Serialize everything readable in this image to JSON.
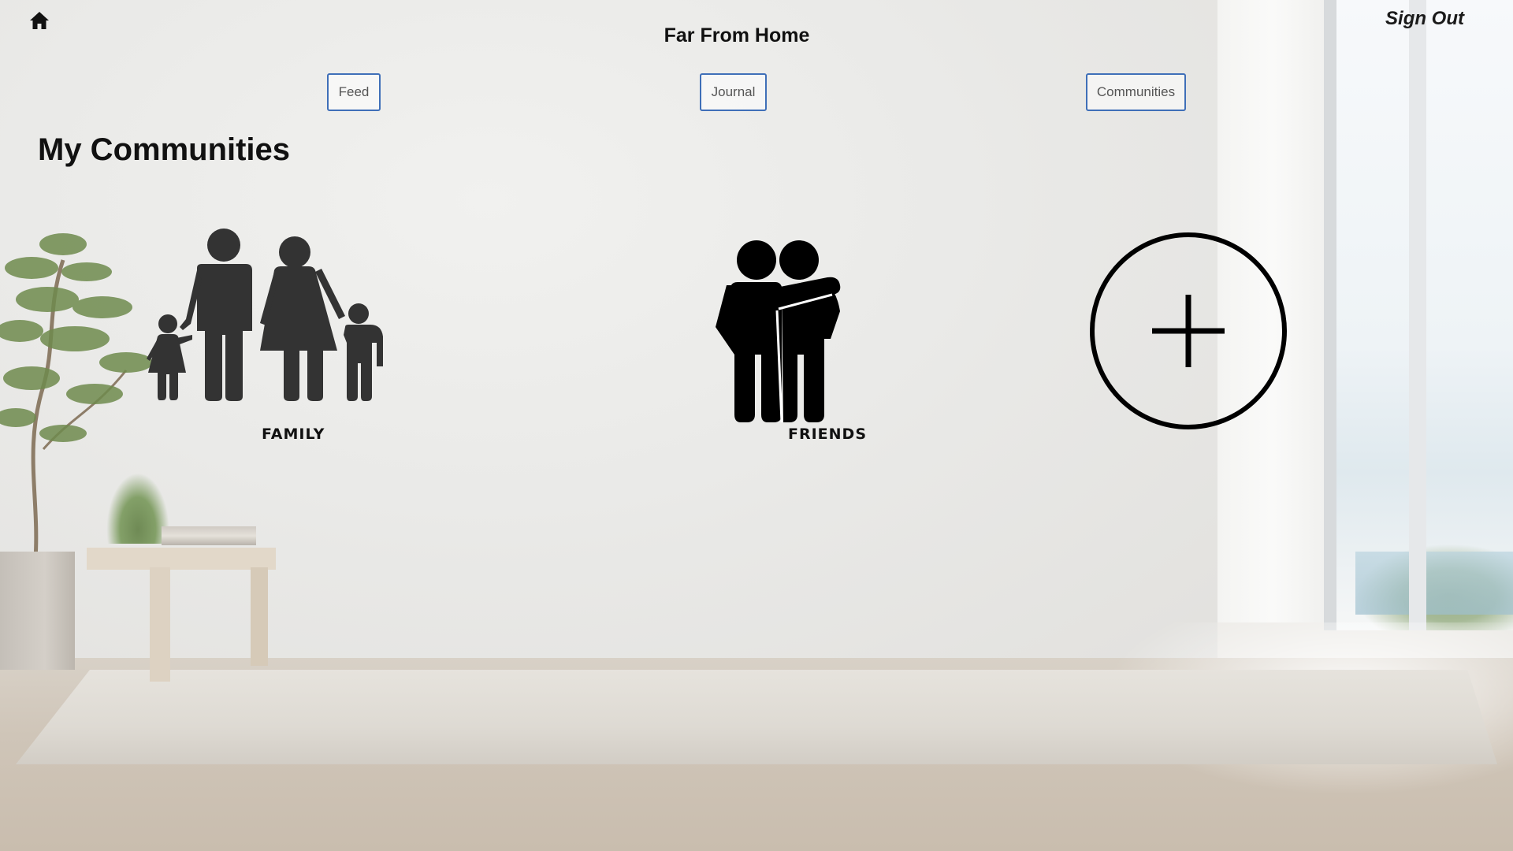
{
  "app": {
    "title": "Far From Home",
    "sign_out_label": "Sign Out"
  },
  "nav": {
    "feed": "Feed",
    "journal": "Journal",
    "communities": "Communities"
  },
  "page": {
    "section_title": "My Communities"
  },
  "communities": [
    {
      "label": "FAMILY",
      "icon": "family-icon"
    },
    {
      "label": "FRIENDS",
      "icon": "friends-icon"
    }
  ],
  "add_community": {
    "icon": "add-circle-icon"
  },
  "icons": {
    "home": "home-icon"
  },
  "colors": {
    "nav_border": "#3f6fb8",
    "icon": "#333333",
    "text": "#111111"
  }
}
